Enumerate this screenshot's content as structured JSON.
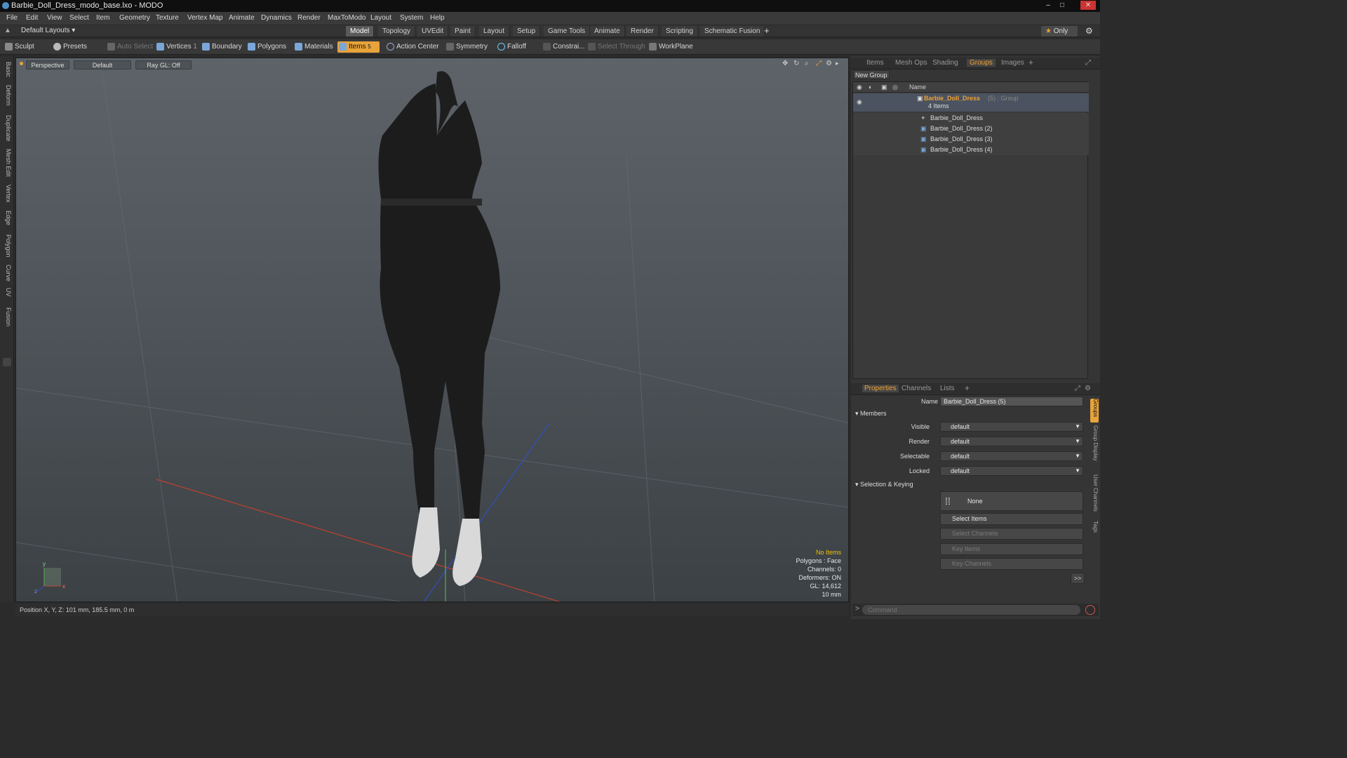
{
  "window": {
    "title": "Barbie_Doll_Dress_modo_base.lxo - MODO"
  },
  "menu": [
    "File",
    "Edit",
    "View",
    "Select",
    "Item",
    "Geometry",
    "Texture",
    "Vertex Map",
    "Animate",
    "Dynamics",
    "Render",
    "MaxToModo",
    "Layout",
    "System",
    "Help"
  ],
  "layout_bar": {
    "preset": "Default Layouts",
    "tabs": [
      "Model",
      "Topology",
      "UVEdit",
      "Paint",
      "Layout",
      "Setup",
      "Game Tools",
      "Animate",
      "Render",
      "Scripting",
      "Schematic Fusion"
    ],
    "active_tab": "Model",
    "only_label": "Only"
  },
  "toolbar": {
    "sculpt": "Sculpt",
    "presets": "Presets",
    "auto_select": "Auto Select",
    "vertices": "Vertices",
    "vertices_count": "1",
    "boundary": "Boundary",
    "polygons": "Polygons",
    "materials": "Materials",
    "items": "Items",
    "items_count": "5",
    "action_center": "Action Center",
    "symmetry": "Symmetry",
    "falloff": "Falloff",
    "constraints": "Constrai...",
    "select_through": "Select Through",
    "workplane": "WorkPlane"
  },
  "left_tabs": [
    "Basic",
    "Deform",
    "Duplicate",
    "Mesh Edit",
    "Vertex",
    "Edge",
    "Polygon",
    "Curve",
    "UV",
    "Fusion"
  ],
  "viewport": {
    "view": "Perspective",
    "shading": "Default",
    "raygl": "Ray GL: Off",
    "info": {
      "selection": "No Items",
      "polygons": "Polygons : Face",
      "channels": "Channels: 0",
      "deformers": "Deformers: ON",
      "gl": "GL: 14,612",
      "scale": "10 mm"
    },
    "axis_labels": {
      "x": "x",
      "y": "y",
      "z": "z"
    }
  },
  "status": {
    "position": "Position X, Y, Z:   101 mm, 185.5 mm, 0 m"
  },
  "top_panel": {
    "tabs": [
      "Items",
      "Mesh Ops",
      "Shading",
      "Groups",
      "Images"
    ],
    "active_tab": "Groups",
    "new_group": "New Group",
    "column_name": "Name",
    "group": {
      "name": "Barbie_Doll_Dress",
      "suffix": "(5) : Group",
      "count": "4 Items"
    },
    "items": [
      "Barbie_Doll_Dress",
      "Barbie_Doll_Dress (2)",
      "Barbie_Doll_Dress (3)",
      "Barbie_Doll_Dress (4)"
    ]
  },
  "properties": {
    "tabs": [
      "Properties",
      "Channels",
      "Lists"
    ],
    "active_tab": "Properties",
    "name_label": "Name",
    "name_value": "Barbie_Doll_Dress (5)",
    "members_section": "Members",
    "fields": [
      {
        "label": "Visible",
        "value": "default"
      },
      {
        "label": "Render",
        "value": "default"
      },
      {
        "label": "Selectable",
        "value": "default"
      },
      {
        "label": "Locked",
        "value": "default"
      }
    ],
    "selection_section": "Selection & Keying",
    "none_label": "None",
    "select_items": "Select Items",
    "select_channels": "Select Channels",
    "key_items": "Key Items",
    "key_channels": "Key Channels",
    "more": ">>"
  },
  "side_tabs": [
    "Groups",
    "Group Display",
    "User Channels",
    "Tags"
  ],
  "command": {
    "prompt": ">",
    "placeholder": "Command"
  },
  "colors": {
    "accent": "#e8a33a",
    "group_name": "#f0a030"
  }
}
